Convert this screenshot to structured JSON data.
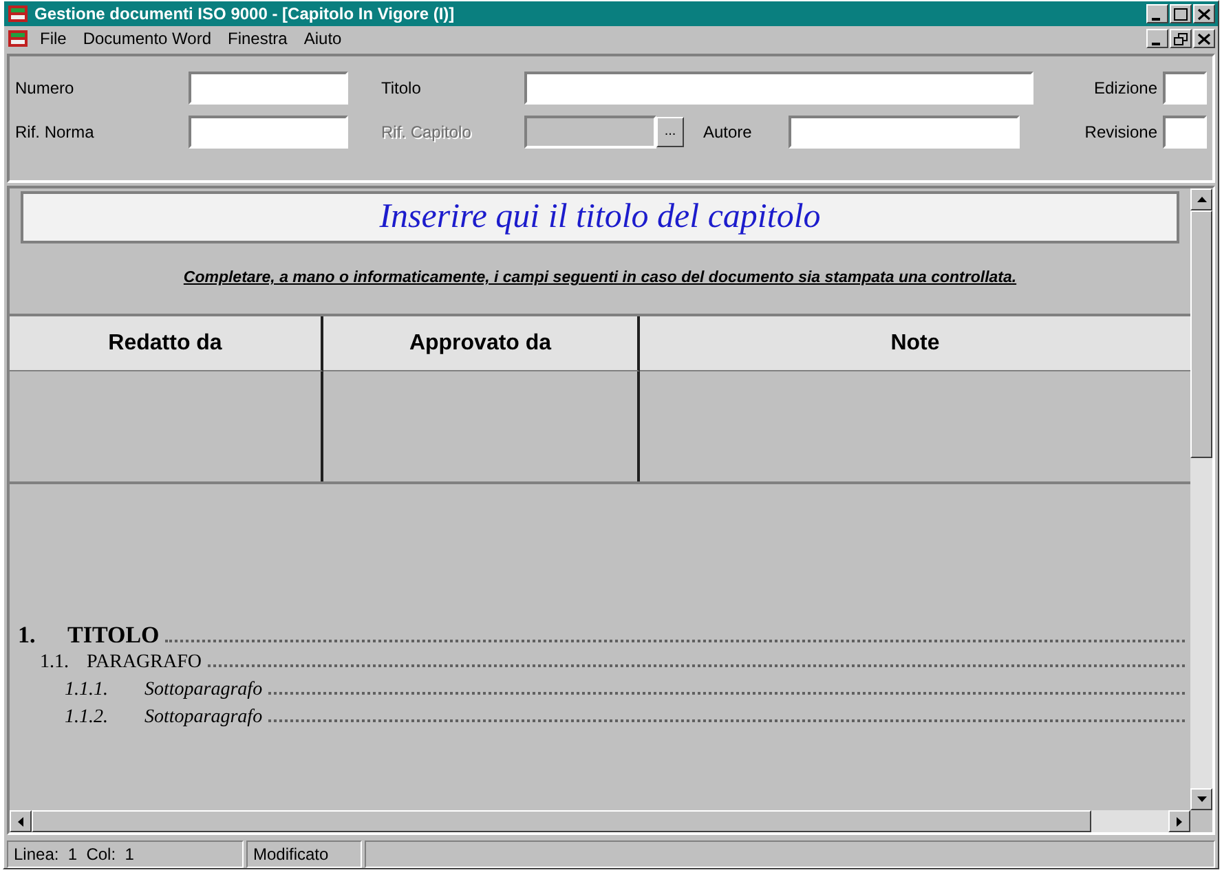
{
  "window": {
    "title": "Gestione documenti ISO 9000 - [Capitolo In Vigore (I)]"
  },
  "menu": [
    "File",
    "Documento Word",
    "Finestra",
    "Aiuto"
  ],
  "form": {
    "row_1": [
      {
        "label": "Numero",
        "disabled": false
      },
      {
        "label": "Titolo",
        "disabled": false
      },
      {
        "label": "Edizione",
        "disabled": false
      }
    ],
    "row_2": [
      {
        "label": "Rif. Norma",
        "disabled": false
      },
      {
        "label": "Rif. Capitolo",
        "disabled": true
      },
      {
        "label": "Autore",
        "disabled": false
      },
      {
        "label": "Revisione",
        "disabled": false
      }
    ],
    "browse_button": "..."
  },
  "document": {
    "chapter_title": "Inserire qui il titolo del capitolo",
    "instruction": "Completare, a mano o informaticamente, i campi seguenti in caso del documento sia stampata una controllata.",
    "table": {
      "columns": [
        "Redatto da",
        "Approvato da",
        "Note"
      ]
    },
    "toc": [
      {
        "number": "1.",
        "title": "TITOLO",
        "children": [
          {
            "number": "1.1.",
            "title": "PARAGRAFO",
            "children": [
              {
                "number": "1.1.1.",
                "title": "Sottoparagrafo"
              },
              {
                "number": "1.1.2.",
                "title": "Sottoparagrafo"
              }
            ]
          }
        ]
      }
    ]
  },
  "status_bar": [
    "Linea:  1  Col:  1",
    "Modificato"
  ]
}
